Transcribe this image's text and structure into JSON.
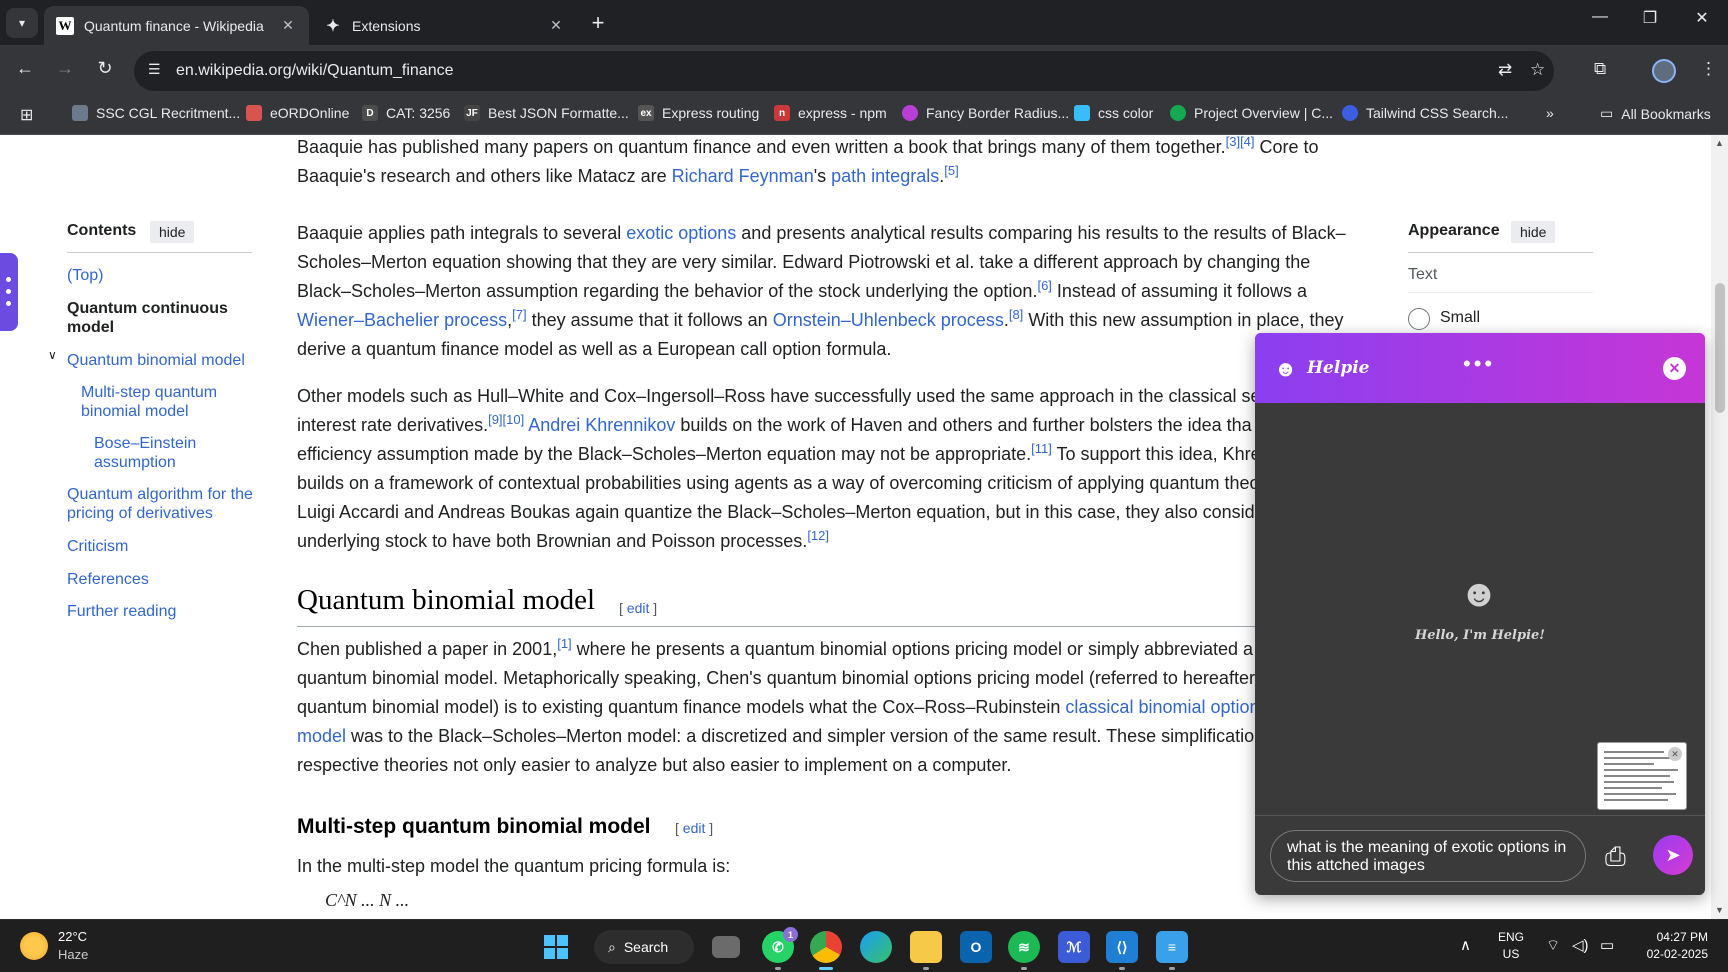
{
  "tabs": [
    {
      "title": "Quantum finance - Wikipedia",
      "favicon": "W"
    },
    {
      "title": "Extensions"
    }
  ],
  "address": {
    "url": "en.wikipedia.org/wiki/Quantum_finance"
  },
  "bookmarks": [
    {
      "label": "SSC CGL Recritment...",
      "color": "#6b7b8c"
    },
    {
      "label": "eORDOnline",
      "color": "#d9534f"
    },
    {
      "label": "CAT: 3256",
      "color": "#4d4d4d"
    },
    {
      "label": "Best JSON Formatte...",
      "color": "#444"
    },
    {
      "label": "Express routing",
      "color": "#555"
    },
    {
      "label": "express - npm",
      "color": "#cb3837"
    },
    {
      "label": "Fancy Border Radius...",
      "color": "#b83fd6"
    },
    {
      "label": "css color",
      "color": "#38bdf8"
    },
    {
      "label": "Project Overview | C...",
      "color": "#13aa52"
    },
    {
      "label": "Tailwind CSS Search...",
      "color": "#3b5fe0"
    }
  ],
  "all_bookmarks": "All Bookmarks",
  "toc": {
    "title": "Contents",
    "hide": "hide",
    "items": [
      "(Top)",
      "Quantum continuous model",
      "Quantum binomial model",
      "Multi-step quantum binomial model",
      "Bose–Einstein assumption",
      "Quantum algorithm for the pricing of derivatives",
      "Criticism",
      "References",
      "Further reading"
    ]
  },
  "appearance": {
    "title": "Appearance",
    "hide": "hide",
    "text_label": "Text",
    "option_small": "Small"
  },
  "content": {
    "p1": {
      "t1": "Baaquie has published many papers on quantum finance and even written a book that brings many of them together.",
      "ref1": "[3][4]",
      "t2": " Core to Baaquie's research and others like Matacz are ",
      "link1": "Richard Feynman",
      "t3": "'s ",
      "link2": "path integrals",
      "t4": ".",
      "ref2": "[5]"
    },
    "p2": {
      "t1": "Baaquie applies path integrals to several ",
      "link1": "exotic options",
      "t2": " and presents analytical results comparing his results to the results of Black–Scholes–Merton equation showing that they are very similar. Edward Piotrowski et al. take a different approach by changing the Black–Scholes–Merton assumption regarding the behavior of the stock underlying the option.",
      "ref1": "[6]",
      "t3": " Instead of assuming it follows a ",
      "link2": "Wiener–Bachelier process",
      "t4": ",",
      "ref2": "[7]",
      "t5": " they assume that it follows an ",
      "link3": "Ornstein–Uhlenbeck process",
      "t6": ".",
      "ref3": "[8]",
      "t7": " With this new assumption in place, they derive a quantum finance model as well as a European call option formula."
    },
    "p3": {
      "t1": "Other models such as Hull–White and Cox–Ingersoll–Ross have successfully used the same approach in the classical se",
      "t2": "interest rate derivatives.",
      "ref1": "[9][10]",
      "link1": "Andrei Khrennikov",
      "t3": " builds on the work of Haven and others and further bolsters the idea tha",
      "t4": "efficiency assumption made by the Black–Scholes–Merton equation may not be appropriate.",
      "ref2": "[11]",
      "t5": " To support this idea, Khre",
      "t6": "builds on a framework of contextual probabilities using agents as a way of overcoming criticism of applying quantum theo",
      "t7": "Luigi Accardi and Andreas Boukas again quantize the Black–Scholes–Merton equation, but in this case, they also consid",
      "t8": "underlying stock to have both Brownian and Poisson processes.",
      "ref3": "[12]"
    },
    "h2": "Quantum binomial model",
    "edit": "edit",
    "p4": {
      "t1": "Chen published a paper in 2001,",
      "ref1": "[1]",
      "t2": " where he presents a quantum binomial options pricing model or simply abbreviated a",
      "t3": "quantum binomial model. Metaphorically speaking, Chen's quantum binomial options pricing model (referred to hereafter",
      "t4": "quantum binomial model) is to existing quantum finance models what the Cox–Ross–Rubinstein ",
      "link1": "classical binomial option",
      "link2": "model",
      "t5": " was to the Black–Scholes–Merton model: a discretized and simpler version of the same result. These simplificatio",
      "t6": "respective theories not only easier to analyze but also easier to implement on a computer."
    },
    "h3": "Multi-step quantum binomial model",
    "p5": "In the multi-step model the quantum pricing formula is:",
    "formula": "C^N  ... N  ..."
  },
  "helpie": {
    "brand": "Helpie",
    "greeting": "Hello, I'm Helpie!",
    "input": "what is the meaning of exotic options in this attched images",
    "accent_from": "#8b3ff0",
    "accent_to": "#c636d6"
  },
  "taskbar": {
    "weather_temp": "22°C",
    "weather_cond": "Haze",
    "search": "Search",
    "whatsapp_badge": "1",
    "lang1": "ENG",
    "lang2": "US",
    "time": "04:27 PM",
    "date": "02-02-2025"
  }
}
